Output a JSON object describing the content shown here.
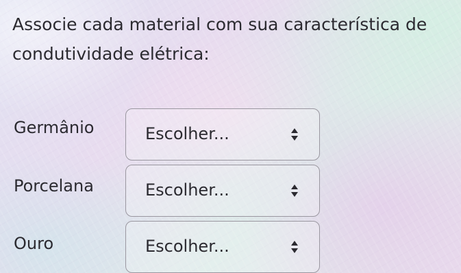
{
  "question": {
    "text": "Associe cada material com sua característica de condutividade elétrica:"
  },
  "rows": [
    {
      "label": "Germânio",
      "select": {
        "value": "Escolher...",
        "icon": "select-arrow-icon"
      }
    },
    {
      "label": "Porcelana",
      "select": {
        "value": "Escolher...",
        "icon": "select-arrow-icon"
      }
    },
    {
      "label": "Ouro",
      "select": {
        "value": "Escolher...",
        "icon": "select-arrow-icon"
      }
    }
  ]
}
